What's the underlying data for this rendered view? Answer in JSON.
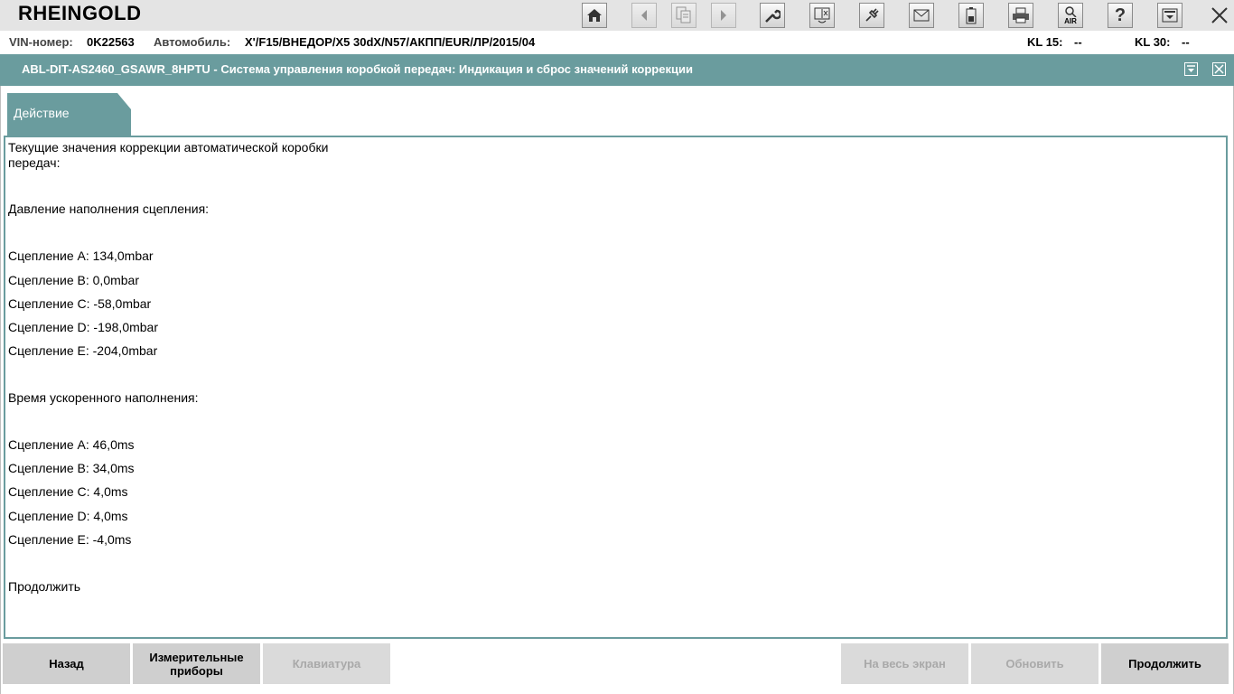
{
  "app": {
    "title": "RHEINGOLD"
  },
  "toolbar": {
    "icons": [
      "home-icon",
      "back-arrow-icon",
      "documents-icon",
      "forward-arrow-icon",
      "wrench-icon",
      "diagnosis-icon",
      "plug-icon",
      "envelope-icon",
      "battery-icon",
      "printer-icon",
      "air-search-icon",
      "help-icon",
      "minimize-icon",
      "close-icon"
    ],
    "air_label": "AIR",
    "help_label": "?"
  },
  "vehicle": {
    "vin_label": "VIN-номер:",
    "vin_value": "0K22563",
    "car_label": "Автомобиль:",
    "car_value": "X'/F15/ВНЕДОР/X5 30dX/N57/АКПП/EUR/ЛР/2015/04",
    "kl15_label": "KL 15:",
    "kl15_value": "--",
    "kl30_label": "KL 30:",
    "kl30_value": "--"
  },
  "window": {
    "title": "ABL-DIT-AS2460_GSAWR_8HPTU  -  Система управления коробкой передач: Индикация и сброс значений коррекции"
  },
  "tab": {
    "label": "Действие"
  },
  "content": {
    "intro_1": "Текущие значения коррекции автоматической коробки",
    "intro_2": "передач:",
    "pressure_heading": "Давление наполнения сцепления:",
    "pressure": [
      "Сцепление A: 134,0mbar",
      "Сцепление B: 0,0mbar",
      "Сцепление C: -58,0mbar",
      "Сцепление D: -198,0mbar",
      "Сцепление E: -204,0mbar"
    ],
    "time_heading": "Время ускоренного наполнения:",
    "time": [
      "Сцепление A: 46,0ms",
      "Сцепление B: 34,0ms",
      "Сцепление C: 4,0ms",
      "Сцепление D: 4,0ms",
      "Сцепление E: -4,0ms"
    ],
    "continue_text": "Продолжить"
  },
  "buttons": {
    "back": "Назад",
    "instruments_1": "Измерительные",
    "instruments_2": "приборы",
    "keyboard": "Клавиатура",
    "fullscreen": "На весь экран",
    "refresh": "Обновить",
    "continue": "Продолжить"
  },
  "colors": {
    "accent": "#6a9c9e",
    "toolbar_bg": "#e4e4e4",
    "button_bg": "#cfcfcf"
  }
}
